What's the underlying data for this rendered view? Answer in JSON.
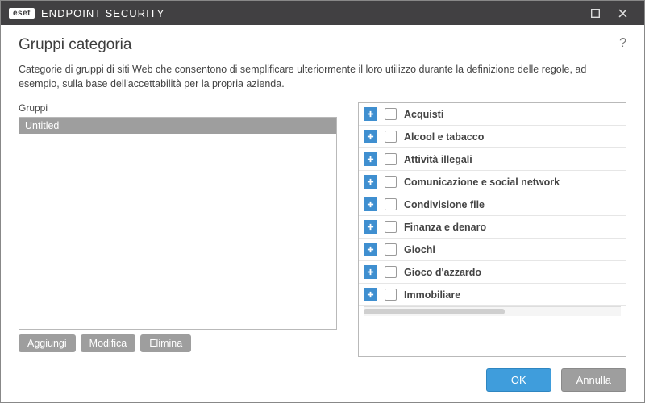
{
  "titlebar": {
    "brand_badge": "eset",
    "brand_text": "ENDPOINT SECURITY"
  },
  "page": {
    "title": "Gruppi categoria",
    "help_glyph": "?",
    "description": "Categorie di gruppi di siti Web che consentono di semplificare ulteriormente il loro utilizzo durante la definizione delle regole, ad esempio, sulla base dell'accettabilità per la propria azienda."
  },
  "groups": {
    "label": "Gruppi",
    "items": [
      "Untitled"
    ],
    "actions": {
      "add": "Aggiungi",
      "edit": "Modifica",
      "delete": "Elimina"
    }
  },
  "categories": {
    "items": [
      {
        "label": "Acquisti",
        "checked": false
      },
      {
        "label": "Alcool e tabacco",
        "checked": false
      },
      {
        "label": "Attività illegali",
        "checked": false
      },
      {
        "label": "Comunicazione e social network",
        "checked": false
      },
      {
        "label": "Condivisione file",
        "checked": false
      },
      {
        "label": "Finanza e denaro",
        "checked": false
      },
      {
        "label": "Giochi",
        "checked": false
      },
      {
        "label": "Gioco d'azzardo",
        "checked": false
      },
      {
        "label": "Immobiliare",
        "checked": false
      }
    ]
  },
  "footer": {
    "ok": "OK",
    "cancel": "Annulla"
  },
  "colors": {
    "accent": "#3f9ddc",
    "expand": "#3f8fd0",
    "grey_btn": "#9e9e9e",
    "titlebar": "#414042"
  }
}
